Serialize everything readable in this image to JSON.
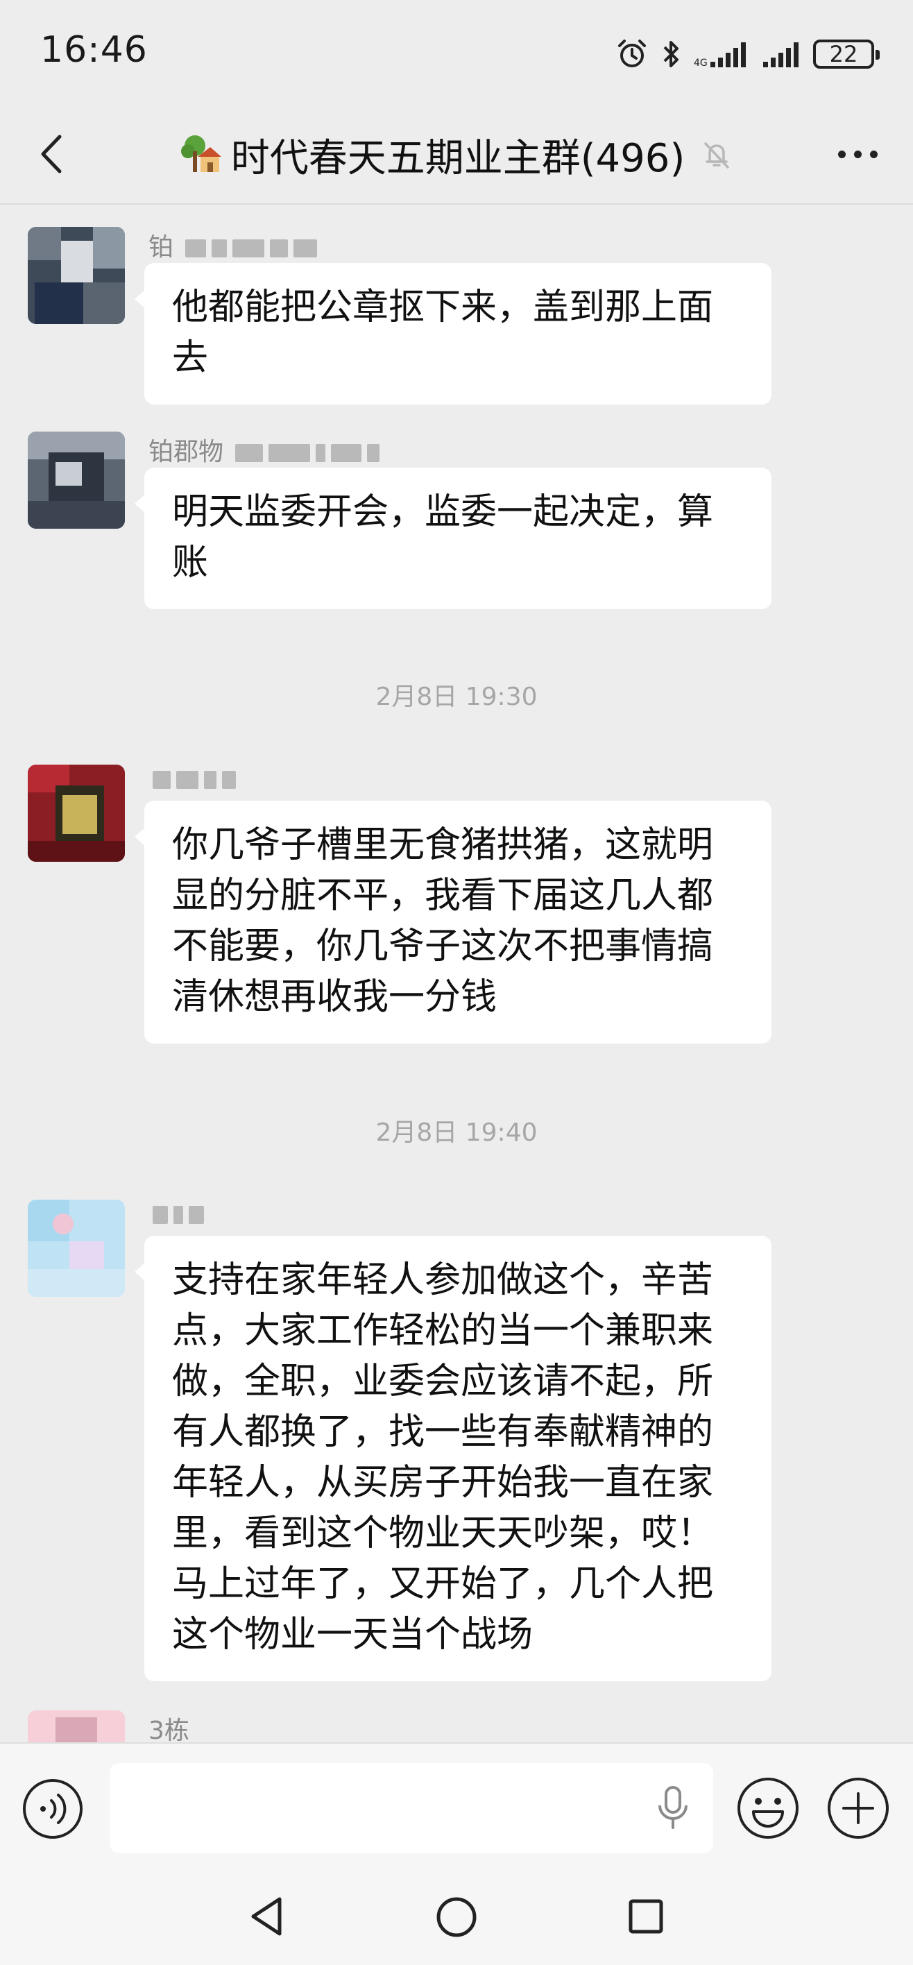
{
  "status_bar": {
    "time": "16:46",
    "battery": "22",
    "icons": [
      "alarm-icon",
      "bluetooth-icon",
      "signal-icon",
      "signal-icon",
      "battery-icon"
    ]
  },
  "header": {
    "back_icon": "chevron-left-icon",
    "group_icon": "house-tree-emoji",
    "title": "时代春天五期业主群(496)",
    "mute_icon": "bell-muted-icon",
    "more_icon": "more-dots-icon"
  },
  "messages": [
    {
      "sender": "铂",
      "text": "他都能把公章抠下来，盖到那上面去"
    },
    {
      "sender": "铂郡物",
      "text": "明天监委开会，监委一起决定，算账"
    },
    {
      "timestamp": "2月8日 19:30"
    },
    {
      "sender": "",
      "text": "你几爷子槽里无食猪拱猪，这就明显的分脏不平，我看下届这几人都不能要，你几爷子这次不把事情搞清休想再收我一分钱"
    },
    {
      "timestamp": "2月8日 19:40"
    },
    {
      "sender": "",
      "text": "支持在家年轻人参加做这个，辛苦点，大家工作轻松的当一个兼职来做，全职，业委会应该请不起，所有人都换了，找一些有奉献精神的年轻人，从买房子开始我一直在家里，看到这个物业天天吵架，哎！马上过年了，又开始了，几个人把这个物业一天当个战场"
    },
    {
      "sender": "3栋",
      "text": ""
    }
  ],
  "input_bar": {
    "voice_icon": "voice-mode-icon",
    "mic_icon": "microphone-icon",
    "emoji_icon": "emoji-icon",
    "plus_icon": "plus-icon",
    "value": ""
  },
  "nav_bar": {
    "icons": [
      "nav-back-icon",
      "nav-home-icon",
      "nav-recents-icon"
    ]
  }
}
